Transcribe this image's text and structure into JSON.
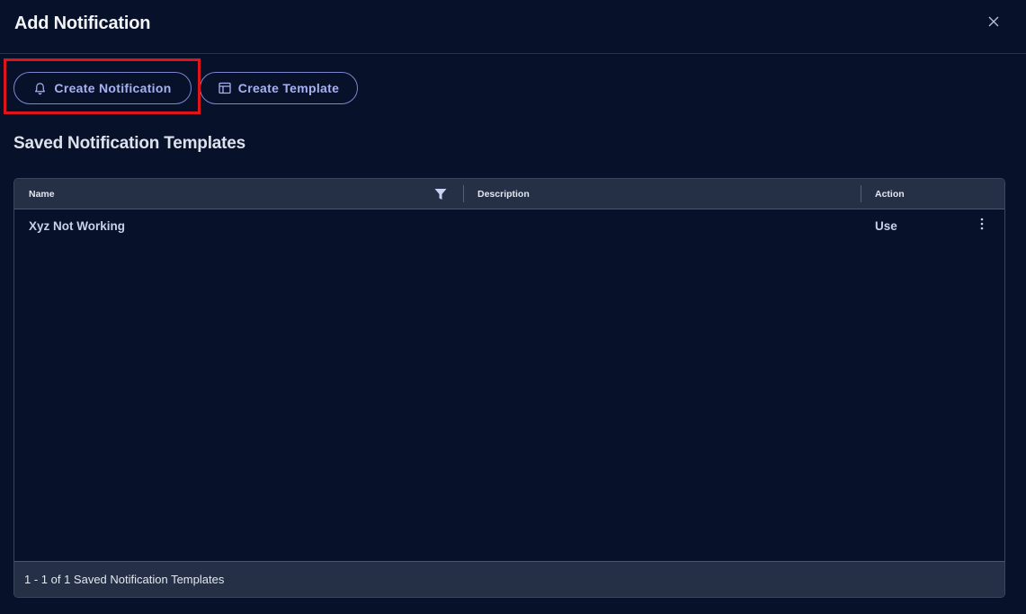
{
  "dialog": {
    "title": "Add Notification",
    "close_icon": "close-icon"
  },
  "toolbar": {
    "create_notification_label": "Create Notification",
    "create_notification_icon": "bell-icon",
    "create_template_label": "Create Template",
    "create_template_icon": "template-icon"
  },
  "section": {
    "title": "Saved Notification Templates"
  },
  "table": {
    "columns": {
      "name": "Name",
      "description": "Description",
      "action": "Action"
    },
    "filter_icon": "filter-icon",
    "rows": [
      {
        "name": "Xyz Not Working",
        "description": "",
        "action": "Use",
        "menu_icon": "more-vertical-icon"
      }
    ],
    "footer": "1 - 1 of 1 Saved Notification Templates"
  },
  "colors": {
    "background": "#07112a",
    "header_row": "#253047",
    "accent": "#a9b2ef",
    "highlight": "#e0141b"
  }
}
